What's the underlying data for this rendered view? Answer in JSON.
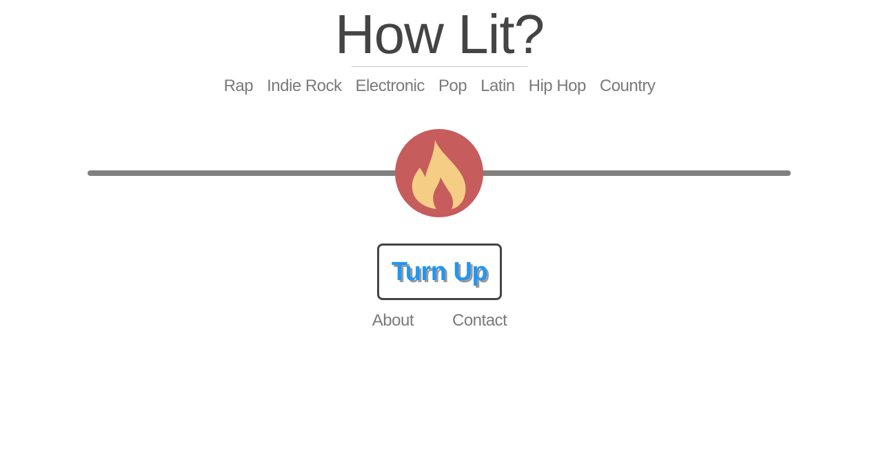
{
  "header": {
    "title": "How Lit?"
  },
  "genres": [
    {
      "label": "Rap"
    },
    {
      "label": "Indie Rock"
    },
    {
      "label": "Electronic"
    },
    {
      "label": "Pop"
    },
    {
      "label": "Latin"
    },
    {
      "label": "Hip Hop"
    },
    {
      "label": "Country"
    }
  ],
  "slider": {
    "value_fraction": 0.5,
    "handle_icon": "flame-icon",
    "track_color": "#808080",
    "handle_color": "#c75c5c",
    "flame_color": "#f5cd85"
  },
  "action": {
    "turn_up_label": "Turn Up",
    "label_color": "#2196f3"
  },
  "footer": {
    "about_label": "About",
    "contact_label": "Contact"
  }
}
